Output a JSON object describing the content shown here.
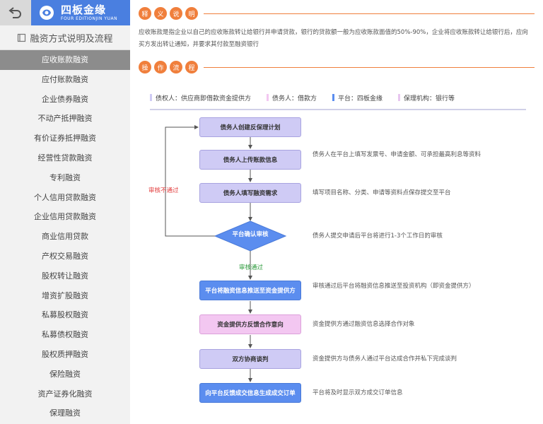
{
  "logo": {
    "name": "四板金缘",
    "en": "FOUR EDITIONJIN YUAN"
  },
  "sidebar": {
    "title": "融资方式说明及流程",
    "items": [
      "应收账款融资",
      "应付账款融资",
      "企业债券融资",
      "不动产抵押融资",
      "有价证券抵押融资",
      "经营性贷款融资",
      "专利融资",
      "个人信用贷款融资",
      "企业信用贷款融资",
      "商业信用贷款",
      "产权交易融资",
      "股权转让融资",
      "增资扩股融资",
      "私募股权融资",
      "私募债权融资",
      "股权质押融资",
      "保险融资",
      "资产证券化融资",
      "保理融资"
    ],
    "active_index": 0
  },
  "section1": {
    "tags": [
      "释",
      "义",
      "说",
      "明"
    ]
  },
  "description": "应收账款是指企业以自己的应收账款转让给银行并申请贷款，银行的贷款额一般为应收账款面值的50%-90%，企业将应收账款转让给银行后，应向买方发出转让通知，并要求其付款至融资银行",
  "section2": {
    "tags": [
      "操",
      "作",
      "流",
      "程"
    ]
  },
  "legend": [
    {
      "label": "债权人：供应商即借款资金提供方",
      "color": "#cfcbf5"
    },
    {
      "label": "债务人：借款方",
      "color": "#f3c7f1"
    },
    {
      "label": "平台：四板金缘",
      "color": "#5b8def"
    },
    {
      "label": "保理机构：银行等",
      "color": "#e8c6f0"
    }
  ],
  "flow": {
    "steps": [
      {
        "label": "债务人创建反保理计划",
        "note": ""
      },
      {
        "label": "债务人上传账款信息",
        "note": "债务人在平台上填写发票号、申请金额、可承担最高利息等资料"
      },
      {
        "label": "债务人填写融资需求",
        "note": "填写项目名称、分类、申请等资料点保存提交至平台"
      }
    ],
    "decision": {
      "label": "平台确认审核",
      "note": "债务人提交申请后平台将进行1-3个工作日的审核"
    },
    "reject_label": "审核不通过",
    "pass_label": "审核通过",
    "steps2": [
      {
        "label": "平台将融资信息推送至资金提供方",
        "note": "审核通过后平台将融资信息推送至投资机构（即资金提供方）"
      },
      {
        "label": "资金提供方反馈合作意向",
        "note": "资金提供方通过融资信息选择合作对象"
      },
      {
        "label": "双方协商谈判",
        "note": "资金提供方与债务人通过平台达成合作并私下完成谈判"
      },
      {
        "label": "向平台反馈成交信息生成成交订单",
        "note": "平台将及时显示双方成交订单信息"
      }
    ]
  },
  "colors": {
    "accent": "#f07f3c",
    "brand": "#4a7fe0"
  }
}
